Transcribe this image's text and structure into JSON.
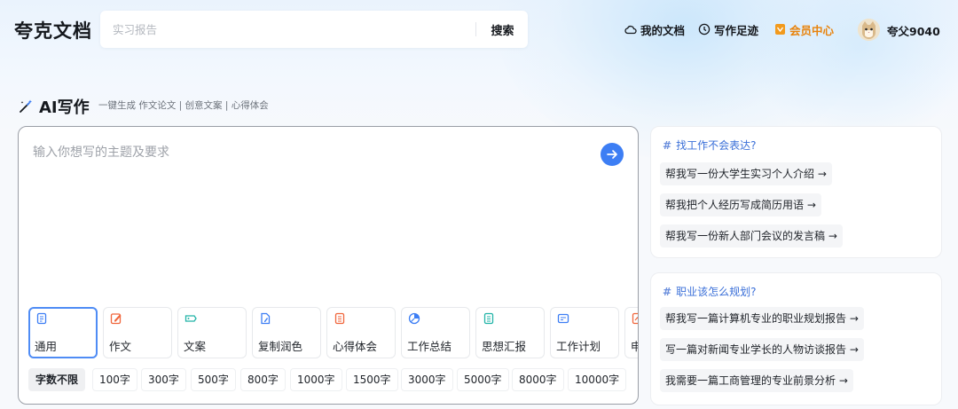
{
  "header": {
    "logo": "夸克文档",
    "search": {
      "placeholder": "实习报告",
      "button": "搜索"
    },
    "nav": [
      {
        "label": "我的文档",
        "icon": "cloud-icon"
      },
      {
        "label": "写作足迹",
        "icon": "clock-icon"
      },
      {
        "label": "会员中心",
        "icon": "vip-icon"
      }
    ],
    "user": {
      "name": "夸父9040",
      "avatar": "cat-avatar"
    }
  },
  "ai": {
    "title": "AI写作",
    "subtitle": "一键生成 作文论文 | 创意文案 | 心得体会",
    "input_placeholder": "输入你想写的主题及要求",
    "types": [
      {
        "label": "通用",
        "icon": "doc-icon",
        "color": "#3d7ef4"
      },
      {
        "label": "作文",
        "icon": "pen-icon",
        "color": "#f0663c"
      },
      {
        "label": "文案",
        "icon": "tag-icon",
        "color": "#23b4a8"
      },
      {
        "label": "复制润色",
        "icon": "polish-icon",
        "color": "#3d7ef4"
      },
      {
        "label": "心得体会",
        "icon": "notes-icon",
        "color": "#f0663c"
      },
      {
        "label": "工作总结",
        "icon": "chart-pie-icon",
        "color": "#3d7ef4"
      },
      {
        "label": "思想汇报",
        "icon": "report-icon",
        "color": "#23b4a8"
      },
      {
        "label": "工作计划",
        "icon": "plan-icon",
        "color": "#3d7ef4"
      },
      {
        "label": "申",
        "icon": "apply-icon",
        "color": "#f0663c"
      }
    ],
    "word_counts": [
      "字数不限",
      "100字",
      "300字",
      "500字",
      "800字",
      "1000字",
      "1500字",
      "3000字",
      "5000字",
      "8000字",
      "10000字"
    ]
  },
  "panels": [
    {
      "title": "找工作不会表达?",
      "items": [
        "帮我写一份大学生实习个人介绍 →",
        "帮我把个人经历写成简历用语 →",
        "帮我写一份新人部门会议的发言稿 →"
      ]
    },
    {
      "title": "职业该怎么规划?",
      "items": [
        "帮我写一篇计算机专业的职业规划报告 →",
        "写一篇对新闻专业学长的人物访谈报告 →",
        "我需要一篇工商管理的专业前景分析 →"
      ]
    }
  ]
}
